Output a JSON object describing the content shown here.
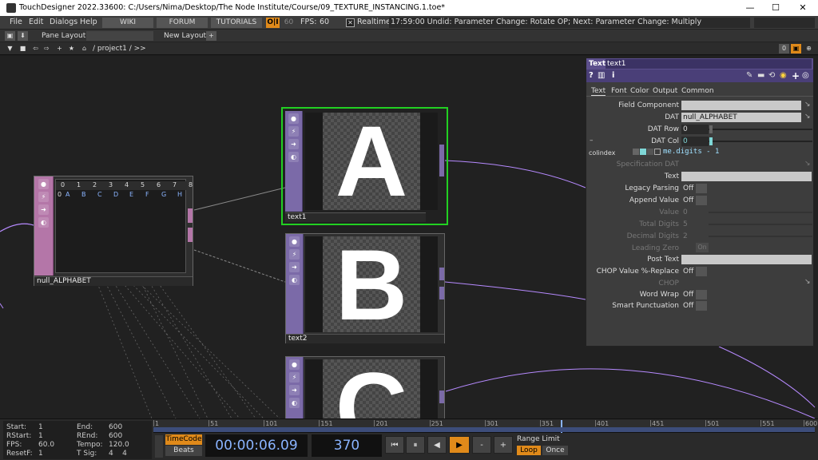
{
  "window": {
    "title": "TouchDesigner 2022.33600: C:/Users/Nima/Desktop/The Node Institute/Course/09_TEXTURE_INSTANCING.1.toe*",
    "min": "—",
    "max": "☐",
    "close": "✕"
  },
  "menu": {
    "file": "File",
    "edit": "Edit",
    "dialogs": "Dialogs",
    "help": "Help",
    "wiki": "WIKI",
    "forum": "FORUM",
    "tutorials": "TUTORIALS",
    "oi": "O|I",
    "fps_target": "60",
    "fps_label": "FPS:",
    "fps_value": "60",
    "realtime_check": "✕",
    "realtime": "Realtime",
    "status": "17:59:00 Undid: Parameter Change: Rotate OP; Next: Parameter Change: Multiply"
  },
  "panebar": {
    "pane_layout": "Pane Layout",
    "new_layout": "New Layout",
    "plus": "+"
  },
  "pathbar": {
    "path": "/ project1 / >>",
    "count": "0"
  },
  "operators": {
    "null_alphabet": {
      "name": "null_ALPHABET",
      "col_headers": [
        "0",
        "1",
        "2",
        "3",
        "4",
        "5",
        "6",
        "7",
        "8"
      ],
      "row_values": [
        "A",
        "B",
        "C",
        "D",
        "E",
        "F",
        "G",
        "H"
      ],
      "row_index": "0"
    },
    "text1": {
      "name": "text1",
      "letter": "A"
    },
    "text2": {
      "name": "text2",
      "letter": "B"
    },
    "text3": {
      "letter": "C"
    }
  },
  "params": {
    "op_type": "Text",
    "op_name": "text1",
    "tabs": [
      "Text",
      "Font",
      "Color",
      "Output",
      "Common"
    ],
    "field_component": {
      "label": "Field Component",
      "value": ""
    },
    "dat": {
      "label": "DAT",
      "value": "null_ALPHABET"
    },
    "dat_row": {
      "label": "DAT Row",
      "value": "0"
    },
    "dat_col": {
      "label": "DAT Col",
      "value": "0"
    },
    "colindex": {
      "label": "colindex",
      "expr": "me.digits - 1",
      "dash": "–"
    },
    "spec_dat": {
      "label": "Specification DAT"
    },
    "text": {
      "label": "Text",
      "value": ""
    },
    "legacy": {
      "label": "Legacy Parsing",
      "value": "Off"
    },
    "append": {
      "label": "Append Value",
      "value": "Off"
    },
    "value": {
      "label": "Value",
      "value": "0"
    },
    "total_digits": {
      "label": "Total Digits",
      "value": "5"
    },
    "decimal_digits": {
      "label": "Decimal Digits",
      "value": "2"
    },
    "leading_zero": {
      "label": "Leading Zero",
      "value": "On"
    },
    "post_text": {
      "label": "Post Text",
      "value": ""
    },
    "chop_replace": {
      "label": "CHOP Value %-Replace",
      "value": "Off"
    },
    "chop": {
      "label": "CHOP"
    },
    "word_wrap": {
      "label": "Word Wrap",
      "value": "Off"
    },
    "smart_punct": {
      "label": "Smart Punctuation",
      "value": "Off"
    }
  },
  "timeline": {
    "start_label": "Start:",
    "start": "1",
    "rstart_label": "RStart:",
    "rstart": "1",
    "fps_label": "FPS:",
    "fps": "60.0",
    "resetf_label": "ResetF:",
    "resetf": "1",
    "end_label": "End:",
    "end": "600",
    "rend_label": "REnd:",
    "rend": "600",
    "tempo_label": "Tempo:",
    "tempo": "120.0",
    "tsig_label": "T Sig:",
    "tsig": "4    4",
    "timecode": "TimeCode",
    "beats": "Beats",
    "time": "00:00:06.09",
    "frame": "370",
    "range_limit": "Range Limit",
    "loop": "Loop",
    "once": "Once",
    "ticks": [
      "1",
      "51",
      "101",
      "151",
      "201",
      "251",
      "301",
      "351",
      "401",
      "451",
      "501",
      "551",
      "600"
    ],
    "progress": 0.616
  },
  "colors": {
    "selected": "#22d022",
    "accent_orange": "#e08a1a",
    "top_purple": "#7b6aa8",
    "null_pink": "#b476a8"
  }
}
